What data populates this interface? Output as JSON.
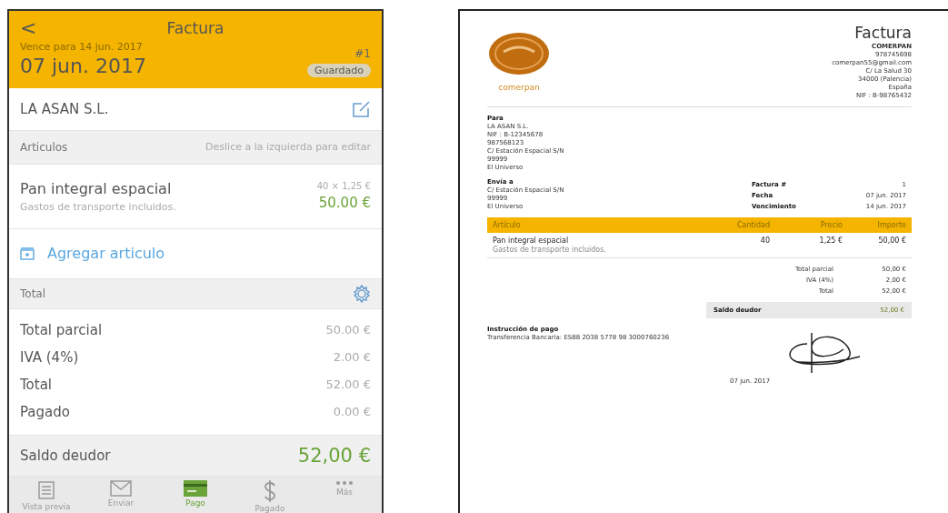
{
  "app": {
    "back": "<",
    "title": "Factura",
    "due": "Vence para 14 jun. 2017",
    "number": "#1",
    "date": "07 jun. 2017",
    "status": "Guardado",
    "client": "LA ASAN S.L.",
    "items_header": "Articulos",
    "items_hint": "Deslice a la izquierda para editar",
    "items": [
      {
        "name": "Pan integral espacial",
        "note": "Gastos de transporte incluidos.",
        "qty_price": "40 × 1,25 €",
        "amount": "50.00 €"
      }
    ],
    "add_item": "Agregar articulo",
    "total_header": "Total",
    "totals": [
      {
        "label": "Total parcial",
        "value": "50.00 €"
      },
      {
        "label": "IVA (4%)",
        "value": "2.00 €"
      },
      {
        "label": "Total",
        "value": "52.00 €"
      },
      {
        "label": "Pagado",
        "value": "0.00 €"
      }
    ],
    "balance": {
      "label": "Saldo deudor",
      "value": "52,00 €"
    },
    "tabs": [
      {
        "label": "Vista previa",
        "kind": "doc",
        "selected": false
      },
      {
        "label": "Enviar",
        "kind": "mail",
        "selected": false
      },
      {
        "label": "Pago",
        "kind": "card",
        "selected": true
      },
      {
        "label": "Pagado",
        "kind": "dollar",
        "selected": false
      },
      {
        "label": "Más",
        "kind": "more",
        "selected": false
      }
    ]
  },
  "document": {
    "logo_text": "comerpan",
    "title": "Factura",
    "company": [
      "COMERPAN",
      "978745698",
      "comerpan55@gmail.com",
      "C/ La Salud 30",
      "34000 (Palencia)",
      "España",
      "NIF : B-98765432"
    ],
    "bill_to": {
      "heading": "Para",
      "lines": [
        "LA ASAN S.L.",
        "NIF : B-12345678",
        "987568123",
        "C/ Estación Espacial S/N",
        "99999",
        "El Universo"
      ]
    },
    "ship_to": {
      "heading": "Envía a",
      "lines": [
        "C/ Estación Espacial S/N",
        "99999",
        "El Universo"
      ]
    },
    "meta": [
      {
        "label": "Factura #",
        "value": "1"
      },
      {
        "label": "Fecha",
        "value": "07 jun. 2017"
      },
      {
        "label": "Vencimiento",
        "value": "14 jun. 2017"
      }
    ],
    "columns": [
      "Artículo",
      "Cantidad",
      "Precio",
      "Importe"
    ],
    "rows": [
      {
        "cells": [
          "Pan integral espacial",
          "40",
          "1,25 €",
          "50,00 €"
        ],
        "note": "Gastos de transporte incluidos."
      }
    ],
    "totals": [
      {
        "label": "Total parcial",
        "value": "50,00 €"
      },
      {
        "label": "IVA (4%)",
        "value": "2,00 €"
      },
      {
        "label": "Total",
        "value": "52,00 €"
      }
    ],
    "balance": {
      "label": "Saldo deudor",
      "value": "52,00 €"
    },
    "payment": {
      "heading": "Instrucción de pago",
      "text": "Transferencia Bancaria: ES88 2038 5778 98 3000760236"
    },
    "signature_date": "07 jun. 2017"
  }
}
